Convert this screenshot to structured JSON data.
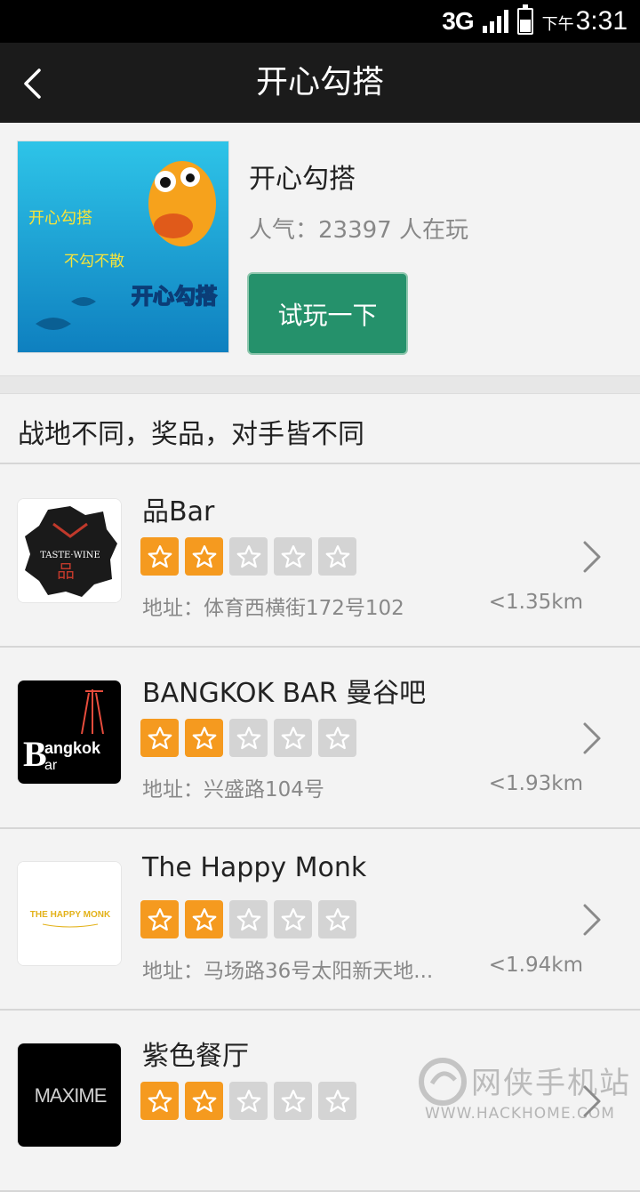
{
  "status_bar": {
    "network": "3G",
    "ampm": "下午",
    "time": "3:31"
  },
  "header": {
    "title": "开心勾搭"
  },
  "game": {
    "name": "开心勾搭",
    "popularity_label": "人气：",
    "popularity_count": "23397",
    "popularity_suffix": " 人在玩",
    "try_button": "试玩一下",
    "thumb_text_top": "开心勾搭",
    "thumb_text_mid": "不勾不散",
    "thumb_logo_text": "开心勾搭"
  },
  "section": {
    "heading": "战地不同，奖品，对手皆不同"
  },
  "bars": [
    {
      "name": "品Bar",
      "address": "地址：体育西横街172号102",
      "distance": "<1.35km",
      "rating": 2,
      "logo_text_1": "TASTE·WINE",
      "logo_text_2": "品"
    },
    {
      "name": "BANGKOK BAR 曼谷吧",
      "address": "地址：兴盛路104号",
      "distance": "<1.93km",
      "rating": 2,
      "logo_text_1": "angkok",
      "logo_text_2": "ar"
    },
    {
      "name": "The Happy Monk",
      "address": "地址：马场路36号太阳新天地...",
      "distance": "<1.94km",
      "rating": 2,
      "logo_text_1": "THE HAPPY MONK",
      "logo_text_2": ""
    },
    {
      "name": "紫色餐厅",
      "address": "",
      "distance": "",
      "rating": 2,
      "logo_text_1": "MAXIME",
      "logo_text_2": ""
    }
  ],
  "watermark": {
    "text": "网侠手机站",
    "url": "WWW.HACKHOME.COM"
  },
  "colors": {
    "accent_green": "#25916b",
    "star_on": "#f59a1f",
    "star_off": "#d4d4d4",
    "title_bar": "#1b1b1b"
  }
}
